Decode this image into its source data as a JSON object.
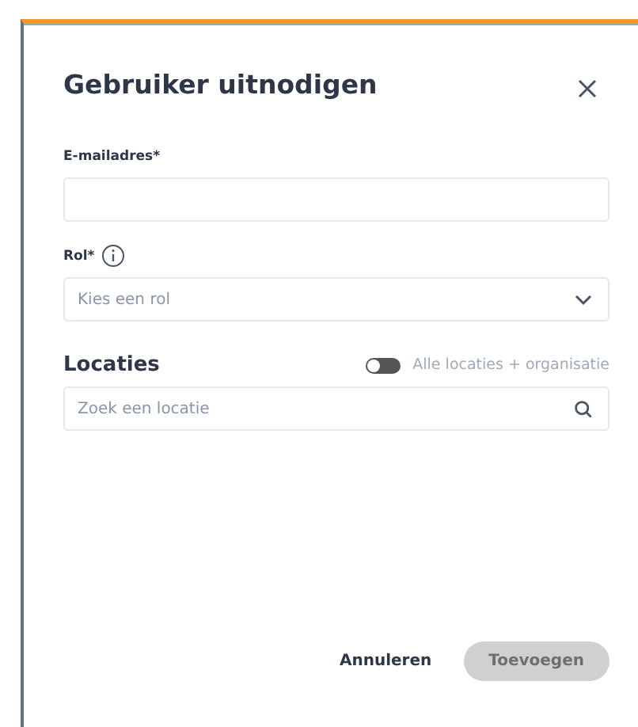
{
  "dialog": {
    "title": "Gebruiker uitnodigen"
  },
  "email": {
    "label": "E-mailadres*"
  },
  "role": {
    "label": "Rol*",
    "placeholder": "Kies een rol"
  },
  "locations": {
    "heading": "Locaties",
    "toggle": {
      "label": "Alle locaties + organisatie",
      "on": false
    },
    "search": {
      "placeholder": "Zoek een locatie"
    }
  },
  "buttons": [
    {
      "kind": "cancel",
      "label": "Annuleren",
      "disabled": false
    },
    {
      "kind": "submit",
      "label": "Toevoegen",
      "disabled": true
    }
  ]
}
